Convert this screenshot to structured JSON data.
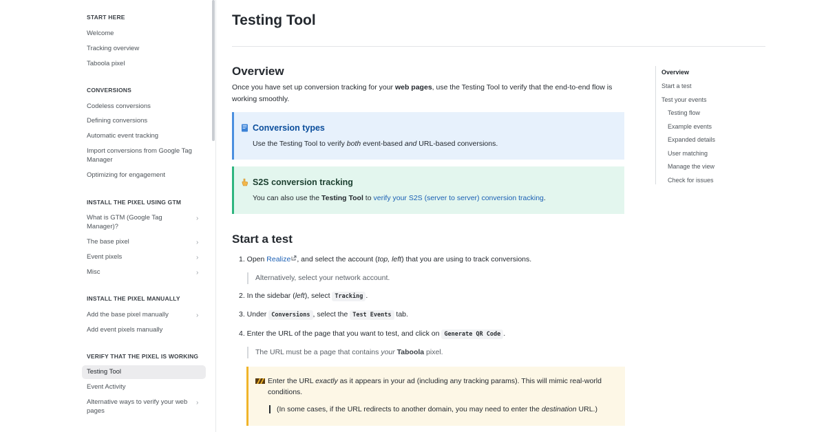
{
  "sidebar": {
    "sections": [
      {
        "heading": "START HERE",
        "items": [
          "Welcome",
          "Tracking overview",
          "Taboola pixel"
        ]
      },
      {
        "heading": "CONVERSIONS",
        "items": [
          "Codeless conversions",
          "Defining conversions",
          "Automatic event tracking",
          "Import conversions from Google Tag Manager",
          "Optimizing for engagement"
        ]
      },
      {
        "heading": "INSTALL THE PIXEL USING GTM",
        "items": [
          "What is GTM (Google Tag Manager)?",
          "The base pixel",
          "Event pixels",
          "Misc"
        ]
      },
      {
        "heading": "INSTALL THE PIXEL MANUALLY",
        "items": [
          "Add the base pixel manually",
          "Add event pixels manually"
        ]
      },
      {
        "heading": "VERIFY THAT THE PIXEL IS WORKING",
        "items": [
          "Testing Tool",
          "Event Activity",
          "Alternative ways to verify your web pages"
        ]
      }
    ],
    "active_item": "Testing Tool"
  },
  "main": {
    "title": "Testing Tool",
    "overview": {
      "heading": "Overview",
      "text_before": "Once you have set up conversion tracking for your ",
      "text_bold": "web pages",
      "text_after": ", use the Testing Tool to verify that the end-to-end flow is working smoothly."
    },
    "callout_info": {
      "title": "Conversion types",
      "body_1": "Use the Testing Tool to verify ",
      "body_em1": "both",
      "body_2": " event-based ",
      "body_em2": "and",
      "body_3": " URL-based conversions."
    },
    "callout_s2s": {
      "title": "S2S conversion tracking",
      "body_1": "You can also use the ",
      "body_bold": "Testing Tool",
      "body_2": " to ",
      "body_link": "verify your S2S (server to server) conversion tracking",
      "body_3": "."
    },
    "start": {
      "heading": "Start a test",
      "step1_pre": "1. Open ",
      "step1_link": "Realize",
      "step1_a": ", and select the account (",
      "step1_em1": "top, left",
      "step1_b": ") that you are using to track conversions.",
      "step1_note": "Alternatively, select your network account.",
      "step2_pre": "2. In the sidebar (",
      "step2_em": "left",
      "step2_mid": "), select ",
      "step2_code": "Tracking",
      "step2_post": ".",
      "step3_pre": "3. Under ",
      "step3_code1": "Conversions",
      "step3_mid": ", select the ",
      "step3_code2": "Test Events",
      "step3_post": " tab.",
      "step4_pre": "4. Enter the URL of the page that you want to test, and click on ",
      "step4_code": "Generate QR Code",
      "step4_post": ".",
      "step4_note_pre": "The URL must be a page that contains ",
      "step4_note_em": "your",
      "step4_note_bold": " Taboola",
      "step4_note_post": " pixel.",
      "warn_pre": "Enter the URL ",
      "warn_em": "exactly",
      "warn_post": " as it appears in your ad (including any tracking params). This will mimic real-world conditions.",
      "warn_note_pre": "(In some cases, if the URL redirects to another domain, you may need to enter the ",
      "warn_note_em": "destination",
      "warn_note_post": " URL.)"
    }
  },
  "toc": {
    "items": [
      {
        "label": "Overview",
        "level": 1,
        "active": true
      },
      {
        "label": "Start a test",
        "level": 1
      },
      {
        "label": "Test your events",
        "level": 1
      },
      {
        "label": "Testing flow",
        "level": 2
      },
      {
        "label": "Example events",
        "level": 2
      },
      {
        "label": "Expanded details",
        "level": 2
      },
      {
        "label": "User matching",
        "level": 2
      },
      {
        "label": "Manage the view",
        "level": 2
      },
      {
        "label": "Check for issues",
        "level": 2
      }
    ]
  },
  "colors": {
    "info_accent": "#4a8fdf",
    "success_accent": "#2fb57f",
    "warning_accent": "#f0b429",
    "link": "#1a5fb4"
  },
  "icons": {
    "info": "book-icon",
    "s2s": "hand-pointing-icon",
    "warning": "caution-stripes-icon",
    "external": "external-link-icon",
    "chevron": "chevron-right-icon"
  }
}
